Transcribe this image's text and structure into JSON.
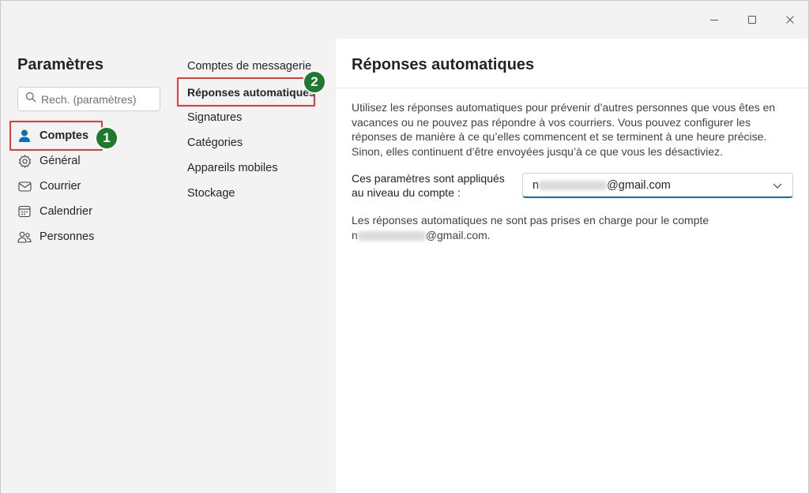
{
  "window": {
    "controls": {
      "minimize_icon": "minimize-icon",
      "maximize_icon": "maximize-icon",
      "close_icon": "close-icon"
    }
  },
  "sidebar": {
    "title": "Paramètres",
    "search": {
      "placeholder": "Rech. (paramètres)"
    },
    "items": [
      {
        "label": "Comptes",
        "icon": "person-icon",
        "active": true
      },
      {
        "label": "Général",
        "icon": "gear-icon"
      },
      {
        "label": "Courrier",
        "icon": "mail-icon"
      },
      {
        "label": "Calendrier",
        "icon": "calendar-icon"
      },
      {
        "label": "Personnes",
        "icon": "people-icon"
      }
    ]
  },
  "subnav": {
    "items": [
      {
        "label": "Comptes de messagerie"
      },
      {
        "label": "Réponses automatiques",
        "active": true
      },
      {
        "label": "Signatures"
      },
      {
        "label": "Catégories"
      },
      {
        "label": "Appareils mobiles"
      },
      {
        "label": "Stockage"
      }
    ]
  },
  "annotations": {
    "badge1": "1",
    "badge2": "2",
    "highlight_color": "#e03c3c",
    "badge_color": "#1f7a2e"
  },
  "content": {
    "title": "Réponses automatiques",
    "description": "Utilisez les réponses automatiques pour prévenir d’autres personnes que vous êtes en vacances ou ne pouvez pas répondre à vos courriers. Vous pouvez configurer les réponses de manière à ce qu’elles commencent et se terminent à une heure précise. Sinon, elles continuent d’être envoyées jusqu’à ce que vous les désactiviez.",
    "account_label": "Ces paramètres sont appliqués au niveau du compte :",
    "account": {
      "prefix": "n",
      "suffix": "@gmail.com"
    },
    "note_line1": "Les réponses automatiques ne sont pas prises en charge pour le compte",
    "note_prefix": "n",
    "note_suffix": "@gmail.com."
  },
  "colors": {
    "accent": "#0f6cbd",
    "background": "#f3f3f3",
    "panel": "#ffffff"
  }
}
